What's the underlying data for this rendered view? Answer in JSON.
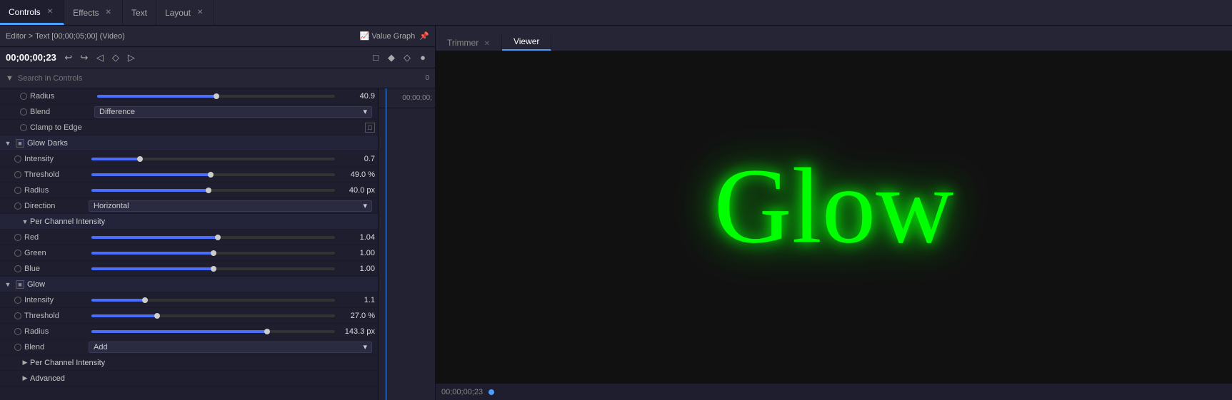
{
  "tabs": [
    {
      "id": "controls",
      "label": "Controls",
      "active": true,
      "closeable": true
    },
    {
      "id": "effects",
      "label": "Effects",
      "active": false,
      "closeable": true
    },
    {
      "id": "text",
      "label": "Text",
      "active": false,
      "closeable": false
    },
    {
      "id": "layout",
      "label": "Layout",
      "active": false,
      "closeable": true
    }
  ],
  "panel": {
    "breadcrumb": "Editor > Text [00;00;05;00] (Video)",
    "value_graph_label": "Value Graph",
    "time_display": "00;00;00;23"
  },
  "timeline": {
    "time_marker": "00;00;00;"
  },
  "search": {
    "placeholder": "Search in Controls"
  },
  "controls": [
    {
      "type": "prop",
      "label": "Radius",
      "value": "40.9",
      "slider_pct": 50,
      "indent": 1
    },
    {
      "type": "prop_dropdown",
      "label": "Blend",
      "value": "Difference",
      "indent": 1
    },
    {
      "type": "prop_checkbox",
      "label": "Clamp to Edge",
      "indent": 1
    },
    {
      "type": "section",
      "label": "Glow Darks",
      "checked": true
    },
    {
      "type": "prop",
      "label": "Intensity",
      "value": "0.7",
      "slider_pct": 20,
      "indent": 2
    },
    {
      "type": "prop",
      "label": "Threshold",
      "value": "49.0 %",
      "slider_pct": 49,
      "indent": 2
    },
    {
      "type": "prop",
      "label": "Radius",
      "value": "40.0 px",
      "slider_pct": 48,
      "indent": 2
    },
    {
      "type": "prop_dropdown",
      "label": "Direction",
      "value": "Horizontal",
      "indent": 2
    },
    {
      "type": "subsection",
      "label": "Per Channel Intensity",
      "indent": 1
    },
    {
      "type": "prop",
      "label": "Red",
      "value": "1.04",
      "slider_pct": 52,
      "indent": 2
    },
    {
      "type": "prop",
      "label": "Green",
      "value": "1.00",
      "slider_pct": 50,
      "indent": 2
    },
    {
      "type": "prop",
      "label": "Blue",
      "value": "1.00",
      "slider_pct": 50,
      "indent": 2
    },
    {
      "type": "section",
      "label": "Glow",
      "checked": true
    },
    {
      "type": "prop",
      "label": "Intensity",
      "value": "1.1",
      "slider_pct": 22,
      "indent": 2
    },
    {
      "type": "prop",
      "label": "Threshold",
      "value": "27.0 %",
      "slider_pct": 27,
      "indent": 2
    },
    {
      "type": "prop",
      "label": "Radius",
      "value": "143.3 px",
      "slider_pct": 72,
      "indent": 2
    },
    {
      "type": "prop_dropdown",
      "label": "Blend",
      "value": "Add",
      "indent": 2
    },
    {
      "type": "subsection_collapsed",
      "label": "Per Channel Intensity",
      "indent": 1
    },
    {
      "type": "subsection_collapsed",
      "label": "Advanced",
      "indent": 1
    }
  ],
  "viewer": {
    "trimmer_label": "Trimmer",
    "viewer_label": "Viewer",
    "time_display": "00;00;00;23",
    "glow_text": "Glow"
  }
}
